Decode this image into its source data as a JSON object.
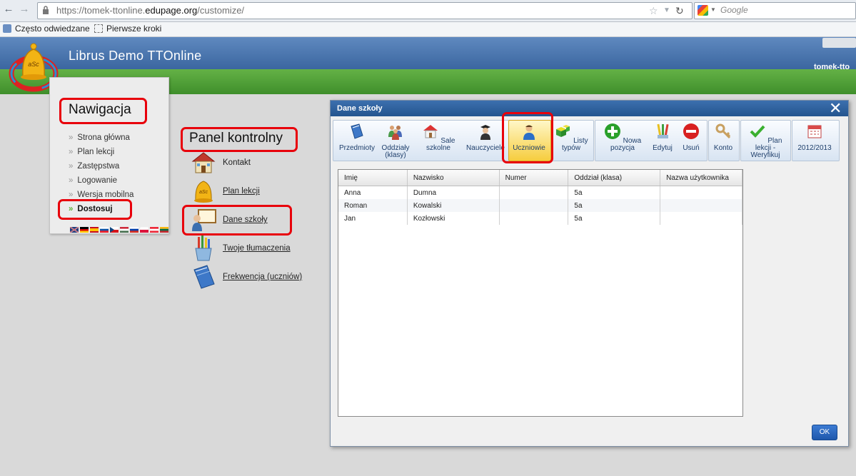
{
  "browser": {
    "url_prefix": "https://tomek-ttonline.",
    "url_domain": "edupage.org",
    "url_path": "/customize/",
    "search_placeholder": "Google",
    "bookmarks": [
      "Często odwiedzane",
      "Pierwsze kroki"
    ]
  },
  "header": {
    "title": "Librus Demo TTOnline",
    "user": "tomek-tto",
    "logo_text": "aSc"
  },
  "nav": {
    "heading": "Nawigacja",
    "items": [
      "Strona główna",
      "Plan lekcji",
      "Zastępstwa",
      "Logowanie",
      "Wersja mobilna",
      "Dostosuj"
    ]
  },
  "control_panel": {
    "heading": "Panel kontrolny",
    "items": [
      "Kontakt",
      "Plan lekcji",
      "Dane szkoły",
      "Twoje tłumaczenia",
      "Frekwencja (uczniów)"
    ]
  },
  "dialog": {
    "title": "Dane szkoły",
    "toolbar": [
      {
        "label": "Przedmioty",
        "icon": "book-icon"
      },
      {
        "label": "Oddziały (klasy)",
        "icon": "group-icon"
      },
      {
        "label": "Sale szkolne",
        "icon": "house-icon"
      },
      {
        "label": "Nauczyciele",
        "icon": "teacher-icon"
      },
      {
        "label": "Uczniowie",
        "icon": "student-icon"
      },
      {
        "label": "Listy typów",
        "icon": "blocks-icon"
      },
      {
        "label": "Nowa pozycja",
        "icon": "plus-icon"
      },
      {
        "label": "Edytuj",
        "icon": "pencil-icon"
      },
      {
        "label": "Usuń",
        "icon": "remove-icon"
      },
      {
        "label": "Konto",
        "icon": "key-icon"
      },
      {
        "label": "Plan lekcji - Weryfikuj",
        "icon": "check-icon"
      },
      {
        "label": "2012/2013",
        "icon": "calendar-icon"
      }
    ],
    "columns": [
      "Imię",
      "Nazwisko",
      "Numer",
      "Oddział (klasa)",
      "Nazwa użytkownika"
    ],
    "rows": [
      [
        "Anna",
        "Dumna",
        "",
        "5a",
        ""
      ],
      [
        "Roman",
        "Kowalski",
        "",
        "5a",
        ""
      ],
      [
        "Jan",
        "Kozłowski",
        "",
        "5a",
        ""
      ]
    ],
    "ok_label": "OK"
  }
}
